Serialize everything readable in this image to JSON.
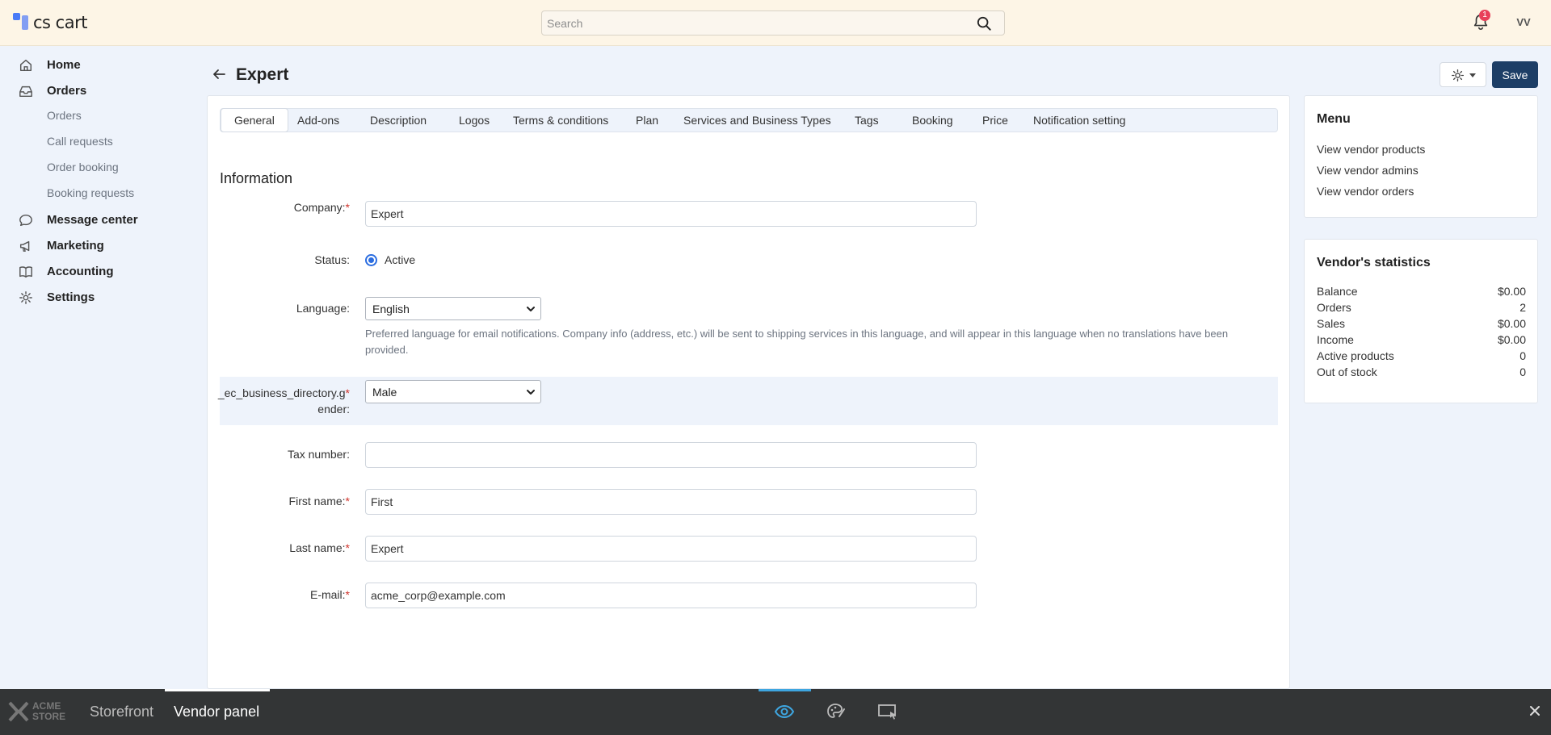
{
  "header": {
    "logo_text": "cs cart",
    "search_placeholder": "Search",
    "notification_count": "1",
    "avatar_initials": "VV"
  },
  "sidebar": {
    "items": [
      {
        "label": "Home",
        "icon": "home-icon"
      },
      {
        "label": "Orders",
        "icon": "inbox-icon"
      },
      {
        "label": "Message center",
        "icon": "chat-icon"
      },
      {
        "label": "Marketing",
        "icon": "megaphone-icon"
      },
      {
        "label": "Accounting",
        "icon": "book-icon"
      },
      {
        "label": "Settings",
        "icon": "gear-icon"
      }
    ],
    "sub_items": [
      "Orders",
      "Call requests",
      "Order booking",
      "Booking requests"
    ]
  },
  "page": {
    "title": "Expert",
    "save_label": "Save"
  },
  "tabs": [
    "General",
    "Add-ons",
    "Description",
    "Logos",
    "Terms & conditions",
    "Plan",
    "Services and Business Types",
    "Tags",
    "Booking",
    "Price",
    "Notification setting"
  ],
  "active_tab": "General",
  "form": {
    "section_title": "Information",
    "company_label": "Company:",
    "company_value": "Expert",
    "status_label": "Status:",
    "status_value": "Active",
    "language_label": "Language:",
    "language_value": "English",
    "language_hint": "Preferred language for email notifications. Company info (address, etc.) will be sent to shipping services in this language, and will appear in this language when no translations have been provided.",
    "gender_label_line1": "_ec_business_directory.g",
    "gender_label_line2": "ender:",
    "gender_value": "Male",
    "tax_label": "Tax number:",
    "tax_value": "",
    "first_name_label": "First name:",
    "first_name_value": "First",
    "last_name_label": "Last name:",
    "last_name_value": "Expert",
    "email_label": "E-mail:",
    "email_value": "acme_corp@example.com",
    "required_mark": "*"
  },
  "menu_card": {
    "title": "Menu",
    "links": [
      "View vendor products",
      "View vendor admins",
      "View vendor orders"
    ]
  },
  "stats_card": {
    "title": "Vendor's statistics",
    "rows": [
      {
        "label": "Balance",
        "value": "$0.00"
      },
      {
        "label": "Orders",
        "value": "2"
      },
      {
        "label": "Sales",
        "value": "$0.00"
      },
      {
        "label": "Income",
        "value": "$0.00"
      },
      {
        "label": "Active products",
        "value": "0"
      },
      {
        "label": "Out of stock",
        "value": "0"
      }
    ]
  },
  "bottombar": {
    "brand_line1": "ACME",
    "brand_line2": "STORE",
    "storefront_label": "Storefront",
    "vendor_panel_label": "Vendor panel"
  },
  "colors": {
    "header_bg": "#fdf5e6",
    "primary_button": "#1d3e66",
    "accent_blue": "#3ea6e0",
    "required": "#d0342c"
  }
}
